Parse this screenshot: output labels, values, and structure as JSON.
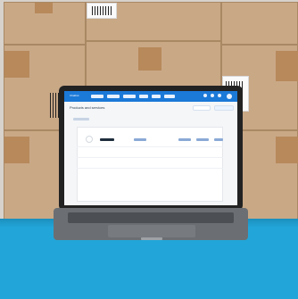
{
  "scene": {
    "subject": "laptop-on-blue-table",
    "background": "stacked-cardboard-boxes"
  },
  "screen_ui": {
    "app_brand": "Chatbot",
    "page_title": "Products and services",
    "nav_items": [
      "Dashboard",
      "Products",
      "Orders",
      "Reports",
      "Customers",
      "Settings"
    ],
    "table_headers": [
      "",
      "Item Name",
      "Description",
      "Unit Price",
      "Sale Price",
      "Quantity"
    ],
    "colors": {
      "app_bar": "#1b79d8",
      "floor": "#22a6d9",
      "box": "#c9a886"
    }
  }
}
